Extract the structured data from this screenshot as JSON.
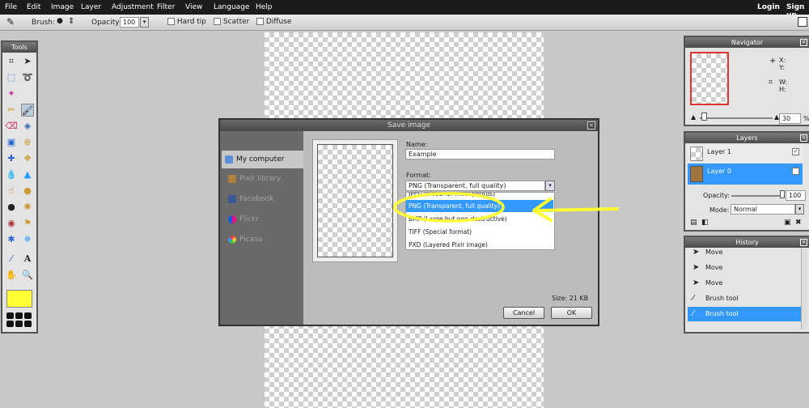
{
  "menu": {
    "items": [
      "File",
      "Edit",
      "Image",
      "Layer",
      "Adjustment",
      "Filter",
      "View",
      "Language",
      "Help"
    ],
    "login": "Login",
    "signup": "Sign up"
  },
  "options": {
    "brush_label": "Brush:",
    "opacity_label": "Opacity:",
    "opacity_value": "100",
    "hard_tip": "Hard tip",
    "scatter": "Scatter",
    "diffuse": "Diffuse"
  },
  "tools": {
    "title": "Tools",
    "primary_color": "#ffff33"
  },
  "navigator": {
    "title": "Navigator",
    "x_label": "X:",
    "y_label": "Y:",
    "w_label": "W:",
    "h_label": "H:",
    "zoom_value": "30",
    "zoom_unit": "%"
  },
  "layers": {
    "title": "Layers",
    "items": [
      {
        "name": "Layer 1"
      },
      {
        "name": "Layer 0"
      }
    ],
    "opacity_label": "Opacity:",
    "opacity_value": "100",
    "mode_label": "Mode:",
    "mode_value": "Normal"
  },
  "history": {
    "title": "History",
    "items": [
      "Move",
      "Move",
      "Move",
      "Brush tool",
      "Brush tool"
    ]
  },
  "dialog": {
    "title": "Save image",
    "sources": [
      "My computer",
      "Pixlr library",
      "Facebook",
      "Flickr",
      "Picasa"
    ],
    "name_label": "Name:",
    "name_value": "Example",
    "format_label": "Format:",
    "format_value": "PNG (Transparent, full quality)",
    "format_options": [
      "JPEG (Good for most photos)",
      "PNG (Transparent, full quality)",
      "BMP (Large but non-destructive)",
      "TIFF (Special format)",
      "PXD (Layered Pixlr image)"
    ],
    "size_text": "Size: 21 KB",
    "cancel_label": "Cancel",
    "ok_label": "OK"
  },
  "colors": {
    "highlight": "#3399ff",
    "annotation": "#ffff33"
  }
}
